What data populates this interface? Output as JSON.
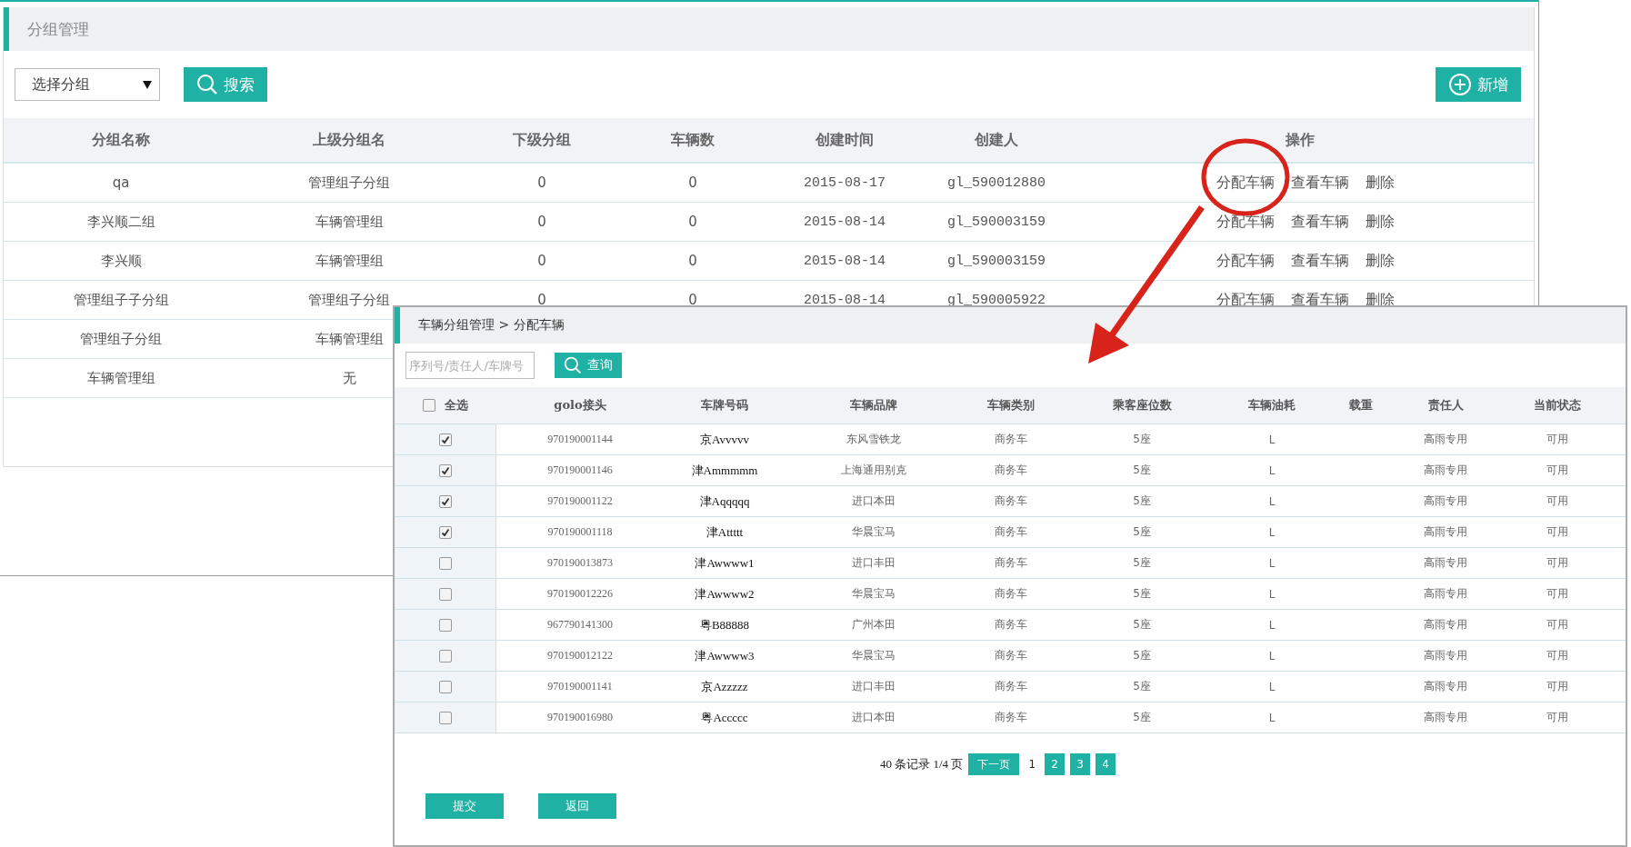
{
  "group_page": {
    "title": "分组管理",
    "group_select": {
      "value": "选择分组"
    },
    "search_button": "搜索",
    "add_button": "新增",
    "columns": [
      "分组名称",
      "上级分组名",
      "下级分组",
      "车辆数",
      "创建时间",
      "创建人",
      "操作"
    ],
    "rows": [
      {
        "cells": [
          "qa",
          "管理组子分组",
          "0",
          "0",
          "2015-08-17",
          "gl_590012880"
        ],
        "actions": [
          "分配车辆",
          "查看车辆",
          "删除"
        ]
      },
      {
        "cells": [
          "李兴顺二组",
          "车辆管理组",
          "0",
          "0",
          "2015-08-14",
          "gl_590003159"
        ],
        "actions": [
          "分配车辆",
          "查看车辆",
          "删除"
        ]
      },
      {
        "cells": [
          "李兴顺",
          "车辆管理组",
          "0",
          "0",
          "2015-08-14",
          "gl_590003159"
        ],
        "actions": [
          "分配车辆",
          "查看车辆",
          "删除"
        ]
      },
      {
        "cells": [
          "管理组子子分组",
          "管理组子分组",
          "0",
          "0",
          "2015-08-14",
          "gl_590005922"
        ],
        "actions": [
          "分配车辆",
          "查看车辆",
          "删除"
        ]
      },
      {
        "cells": [
          "管理组子分组",
          "车辆管理组"
        ]
      },
      {
        "cells": [
          "车辆管理组",
          "无"
        ]
      }
    ]
  },
  "assign_dialog": {
    "breadcrumb": "车辆分组管理 > 分配车辆",
    "search": {
      "placeholder": "序列号/责任人/车牌号"
    },
    "query_button": "查询",
    "select_all": {
      "label": "全选",
      "checked": false
    },
    "columns": [
      "golo接头",
      "车牌号码",
      "车辆品牌",
      "车辆类别",
      "乘客座位数",
      "车辆油耗",
      "载重",
      "责任人",
      "当前状态"
    ],
    "rows": [
      {
        "checked": true,
        "golo": "970190001144",
        "plate": "京Avvvvv",
        "brand": "东风雪铁龙",
        "type": "商务车",
        "seats": "5座",
        "fuel": "L",
        "owner": "高雨专用",
        "status": "可用"
      },
      {
        "checked": true,
        "golo": "970190001146",
        "plate": "津Ammmmm",
        "brand": "上海通用别克",
        "type": "商务车",
        "seats": "5座",
        "fuel": "L",
        "owner": "高雨专用",
        "status": "可用"
      },
      {
        "checked": true,
        "golo": "970190001122",
        "plate": "津Aqqqqq",
        "brand": "进口本田",
        "type": "商务车",
        "seats": "5座",
        "fuel": "L",
        "owner": "高雨专用",
        "status": "可用"
      },
      {
        "checked": true,
        "golo": "970190001118",
        "plate": "津Attttt",
        "brand": "华晨宝马",
        "type": "商务车",
        "seats": "5座",
        "fuel": "L",
        "owner": "高雨专用",
        "status": "可用"
      },
      {
        "checked": false,
        "golo": "970190013873",
        "plate": "津Awwww1",
        "brand": "进口丰田",
        "type": "商务车",
        "seats": "5座",
        "fuel": "L",
        "owner": "高雨专用",
        "status": "可用"
      },
      {
        "checked": false,
        "golo": "970190012226",
        "plate": "津Awwww2",
        "brand": "华晨宝马",
        "type": "商务车",
        "seats": "5座",
        "fuel": "L",
        "owner": "高雨专用",
        "status": "可用"
      },
      {
        "checked": false,
        "golo": "967790141300",
        "plate": "粤B88888",
        "brand": "广州本田",
        "type": "商务车",
        "seats": "5座",
        "fuel": "L",
        "owner": "高雨专用",
        "status": "可用"
      },
      {
        "checked": false,
        "golo": "970190012122",
        "plate": "津Awwww3",
        "brand": "华晨宝马",
        "type": "商务车",
        "seats": "5座",
        "fuel": "L",
        "owner": "高雨专用",
        "status": "可用"
      },
      {
        "checked": false,
        "golo": "970190001141",
        "plate": "京Azzzzz",
        "brand": "进口丰田",
        "type": "商务车",
        "seats": "5座",
        "fuel": "L",
        "owner": "高雨专用",
        "status": "可用"
      },
      {
        "checked": false,
        "golo": "970190016980",
        "plate": "粤Accccc",
        "brand": "进口本田",
        "type": "商务车",
        "seats": "5座",
        "fuel": "L",
        "owner": "高雨专用",
        "status": "可用"
      }
    ],
    "pagination": {
      "summary": "40 条记录 1/4 页",
      "next": "下一页",
      "pages": [
        {
          "label": "1",
          "selected": true
        },
        {
          "label": "2",
          "selected": false
        },
        {
          "label": "3",
          "selected": false
        },
        {
          "label": "4",
          "selected": false
        }
      ]
    },
    "buttons": [
      "提交",
      "返回"
    ]
  }
}
